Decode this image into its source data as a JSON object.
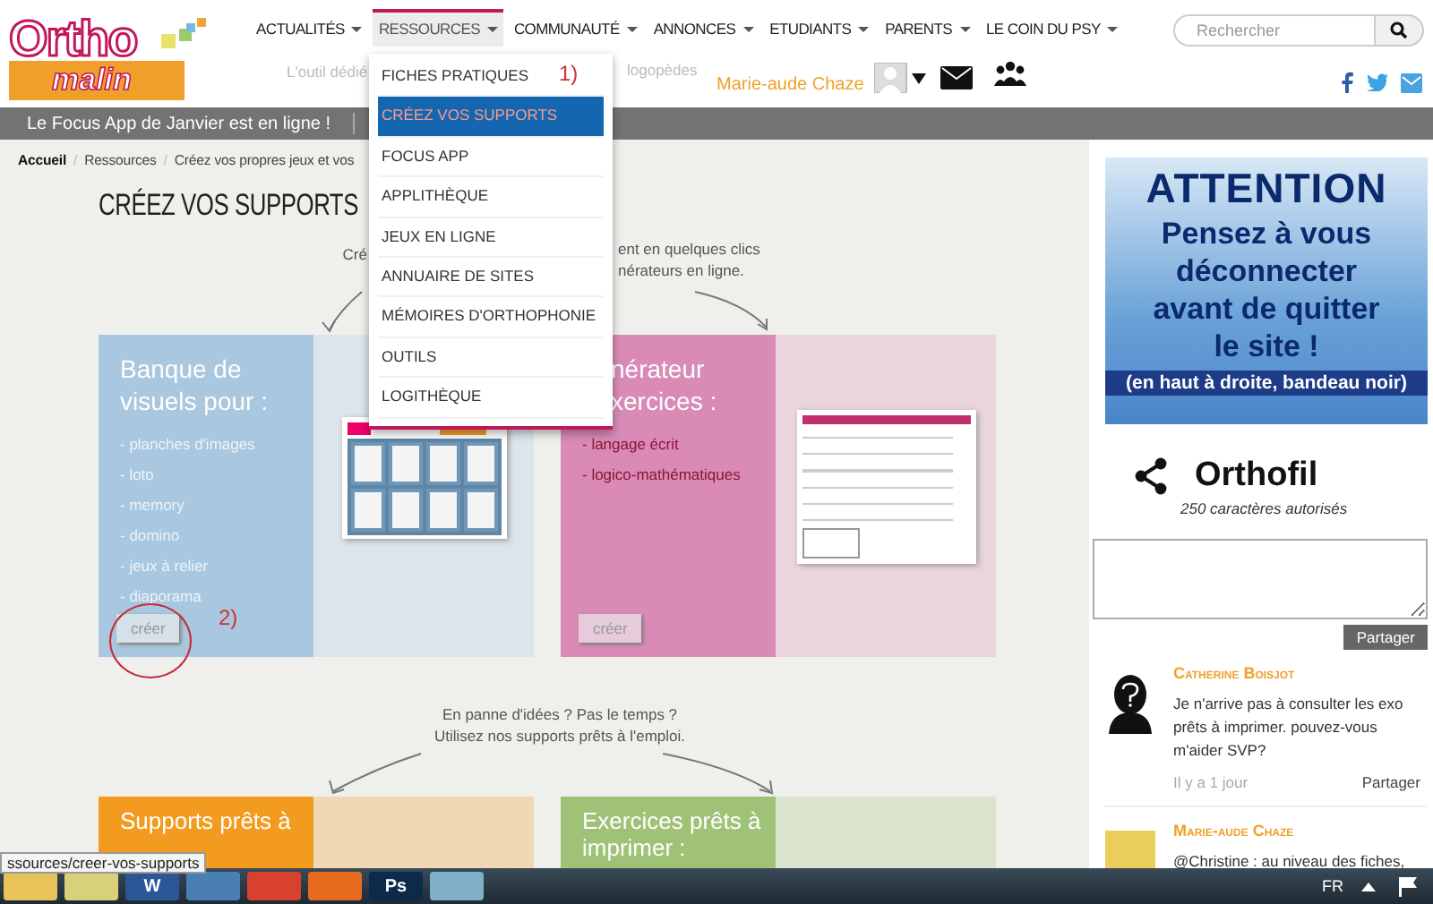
{
  "logo": {
    "line1": "Ortho",
    "line2": "malin"
  },
  "nav": [
    {
      "label": "ACTUALITÉS",
      "selected": false
    },
    {
      "label": "RESSOURCES",
      "selected": true
    },
    {
      "label": "COMMUNAUTÉ",
      "selected": false
    },
    {
      "label": "ANNONCES",
      "selected": false
    },
    {
      "label": "ETUDIANTS",
      "selected": false
    },
    {
      "label": "PARENTS",
      "selected": false
    },
    {
      "label": "LE COIN DU PSY",
      "selected": false
    }
  ],
  "search": {
    "placeholder": "Rechercher"
  },
  "tagline_fragments": [
    "L'outil dédié",
    "logopèdes"
  ],
  "user": {
    "name": "Marie-aude Chaze"
  },
  "announcement": "Le Focus App de Janvier est en ligne !",
  "breadcrumb": [
    "Accueil",
    "Ressources",
    "Créez vos propres jeux et vos"
  ],
  "breadcrumb_separator": "/",
  "page_title": "CRÉEZ VOS SUPPORTS",
  "intro": {
    "left": "Cré",
    "right": [
      "ent en quelques clics",
      "nérateurs en ligne."
    ]
  },
  "cards_top": [
    {
      "title": "Banque de visuels pour :",
      "color": "#a9c7de",
      "items": [
        "- planches d'images",
        "- loto",
        "- memory",
        "- domino",
        "- jeux à relier",
        "- diaporama"
      ],
      "button": "créer"
    },
    {
      "title": "nérateur xercices :",
      "color": "#d98bb6",
      "items": [
        "- langage écrit",
        "- logico-mathématiques"
      ],
      "button": "créer"
    }
  ],
  "middle_text": "En panne d'idées ? Pas le temps ? Utilisez nos supports prêts à l'emploi.",
  "cards_bottom": [
    {
      "title": "Supports prêts à",
      "color": "#f39b1f"
    },
    {
      "title": "Exercices prêts à imprimer :",
      "color": "#9fc277"
    }
  ],
  "dropdown": {
    "items": [
      {
        "label": "FICHES PRATIQUES",
        "selected": false
      },
      {
        "label": "CRÉEZ VOS SUPPORTS",
        "selected": true
      },
      {
        "label": "FOCUS APP",
        "selected": false
      },
      {
        "label": "APPLITHÈQUE",
        "selected": false
      },
      {
        "label": "JEUX EN LIGNE",
        "selected": false
      },
      {
        "label": "ANNUAIRE DE SITES",
        "selected": false
      },
      {
        "label": "MÉMOIRES D'ORTHOPHONIE",
        "selected": false
      },
      {
        "label": "OUTILS",
        "selected": false
      },
      {
        "label": "LOGITHÈQUE",
        "selected": false
      }
    ]
  },
  "annotations": [
    "1)",
    "2)"
  ],
  "alert": {
    "heading": "ATTENTION",
    "message": "Pensez à vous déconnecter avant de quitter le site !",
    "note": "(en haut à droite, bandeau noir)"
  },
  "orthofil": {
    "title": "Orthofil",
    "limit": "250 caractères autorisés",
    "share_button": "Partager"
  },
  "comments": [
    {
      "author": "Catherine Boisjot",
      "kind": "silhouette",
      "text": "Je n'arrive pas à consulter les exo prêts à imprimer. pouvez-vous m'aider SVP?",
      "time": "Il y a 1 jour",
      "action": "Partager"
    },
    {
      "author": "Marie-aude Chaze",
      "kind": "photo",
      "text": "@Christine : au niveau des fiches,"
    }
  ],
  "status_url": "ssources/creer-vos-supports",
  "taskbar": {
    "apps": [
      {
        "kind": "folder"
      },
      {
        "kind": "notes"
      },
      {
        "kind": "word",
        "label": "W"
      },
      {
        "kind": "mail"
      },
      {
        "kind": "chrome"
      },
      {
        "kind": "firefox"
      },
      {
        "kind": "ps",
        "label": "Ps"
      },
      {
        "kind": "tool"
      }
    ],
    "language": "FR"
  }
}
